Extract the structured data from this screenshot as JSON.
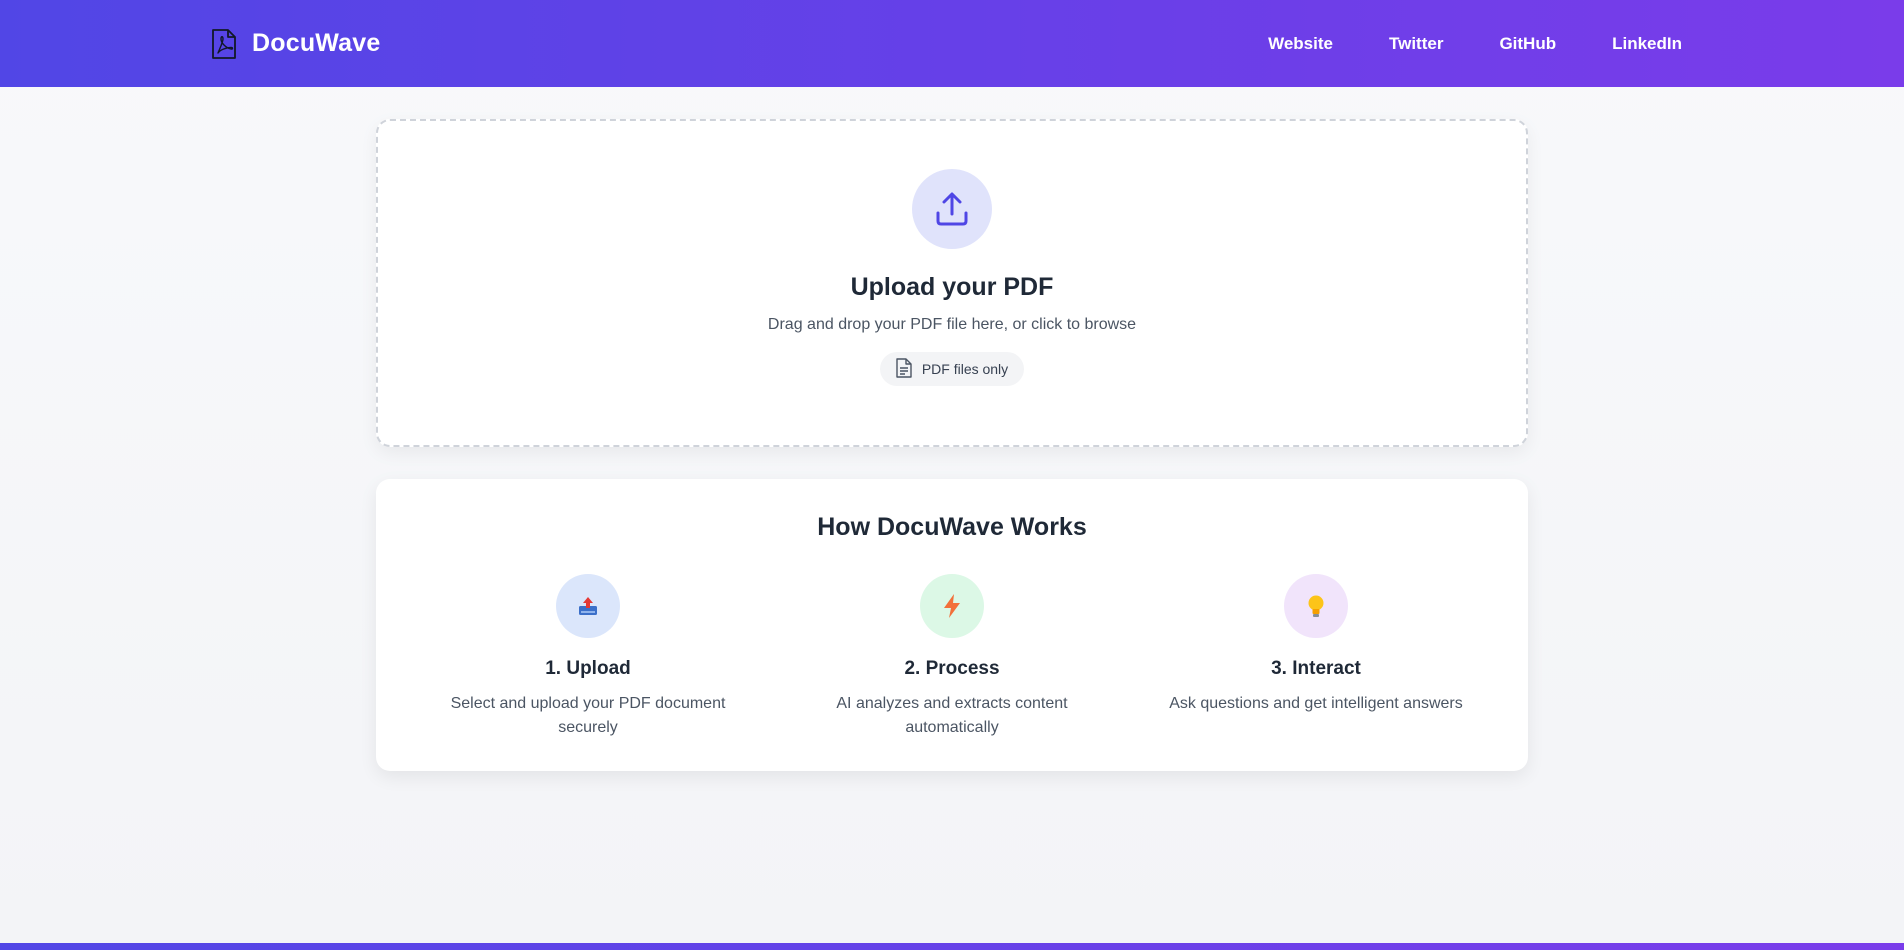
{
  "nav": {
    "brand": "DocuWave",
    "brand_icon": "pdf-file-icon",
    "links": [
      {
        "label": "Website"
      },
      {
        "label": "Twitter"
      },
      {
        "label": "GitHub"
      },
      {
        "label": "LinkedIn"
      }
    ]
  },
  "upload": {
    "icon": "upload-icon",
    "title": "Upload your PDF",
    "subtitle": "Drag and drop your PDF file here, or click to browse",
    "pill_icon": "document-icon",
    "pill_label": "PDF files only"
  },
  "how": {
    "title": "How DocuWave Works",
    "steps": [
      {
        "icon": "inbox-upload-icon",
        "title": "1. Upload",
        "desc": "Select and upload your PDF document securely",
        "bg": "#dbe6fb"
      },
      {
        "icon": "lightning-icon",
        "title": "2. Process",
        "desc": "AI analyzes and extracts content automatically",
        "bg": "#dcf8e6"
      },
      {
        "icon": "lightbulb-icon",
        "title": "3. Interact",
        "desc": "Ask questions and get intelligent answers",
        "bg": "#f1e4fb"
      }
    ]
  },
  "colors": {
    "accent": "#5146e6",
    "accent_end": "#7a3cea",
    "upload_circle": "#e0e3fb"
  }
}
